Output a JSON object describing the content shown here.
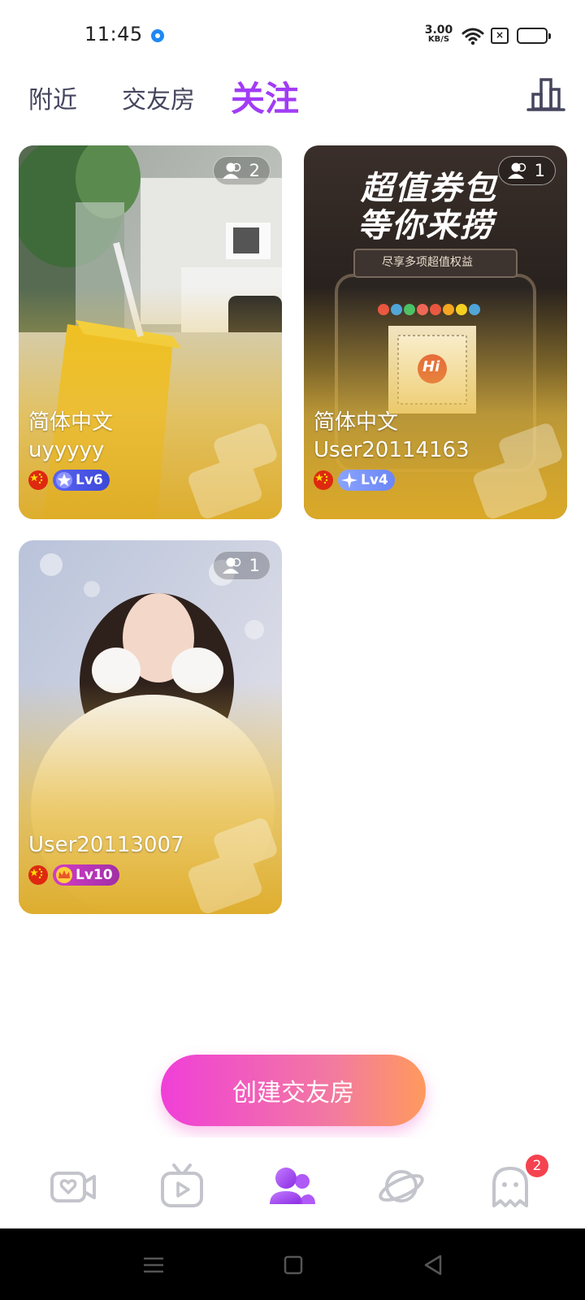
{
  "status_bar": {
    "time": "11:45",
    "net_speed_value": "3.00",
    "net_speed_unit": "KB/S",
    "icons": [
      "app-notification-icon",
      "wifi-icon",
      "sim-off-icon",
      "battery-icon"
    ],
    "battery_color": "#f7d54a"
  },
  "tabs": {
    "items": [
      {
        "label": "附近"
      },
      {
        "label": "交友房"
      },
      {
        "label": "关注"
      }
    ],
    "active_color": "#a13cf6",
    "ranking_icon": "bar-chart-icon"
  },
  "rooms": [
    {
      "room_name": "简体中文",
      "user": "uyyyyy",
      "viewers": "2",
      "level": "Lv6",
      "flag": "china-flag-icon",
      "level_icon": "star-icon"
    },
    {
      "room_name": "简体中文",
      "user": "User20114163",
      "viewers": "1",
      "level": "Lv4",
      "flag": "china-flag-icon",
      "level_icon": "sparkle-icon",
      "poster": {
        "headline_1": "超值券包",
        "headline_2": "等你来捞",
        "subline": "尽享多项超值权益",
        "qr_label": "Hi"
      }
    },
    {
      "room_name": "",
      "user": "User20113007",
      "viewers": "1",
      "level": "Lv10",
      "flag": "china-flag-icon",
      "level_icon": "crown-icon"
    }
  ],
  "create_button": {
    "label": "创建交友房"
  },
  "bottom_nav": {
    "items": [
      {
        "icon": "video-heart-icon"
      },
      {
        "icon": "tv-play-icon"
      },
      {
        "icon": "friends-icon",
        "active": true
      },
      {
        "icon": "planet-icon"
      },
      {
        "icon": "ghost-message-icon",
        "badge": "2"
      }
    ],
    "active_color": "#a13cf6",
    "inactive_color": "#c4c4cc"
  },
  "system_nav": {
    "icons": [
      "menu-icon",
      "home-icon",
      "back-icon"
    ]
  }
}
